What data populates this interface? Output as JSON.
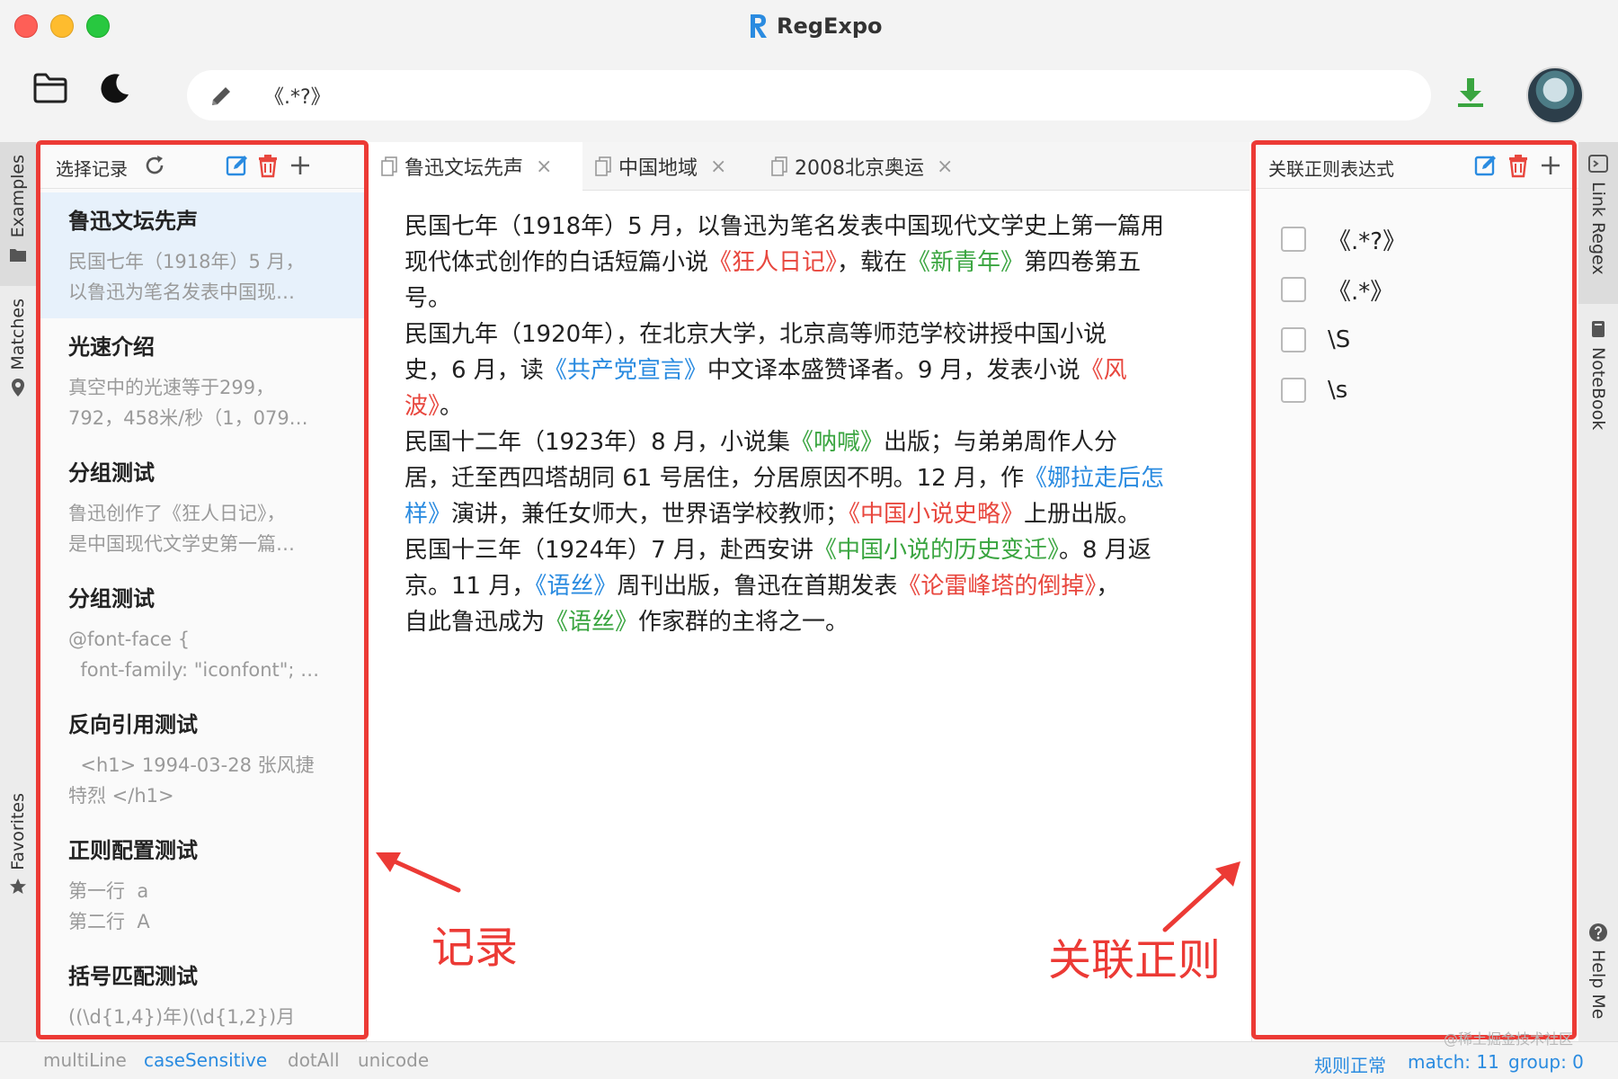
{
  "window": {
    "app_title": "RegExpo"
  },
  "toolbar": {
    "regex_value": "《.*?》"
  },
  "left_tabs": [
    {
      "label": "Examples"
    },
    {
      "label": "Matches"
    },
    {
      "label": "Favorites"
    }
  ],
  "right_tabs": [
    {
      "label": "Link Regex"
    },
    {
      "label": "NoteBook"
    },
    {
      "label": "Help Me"
    }
  ],
  "records_panel": {
    "title": "选择记录",
    "items": [
      {
        "title": "鲁迅文坛先声",
        "preview": "民国七年（1918年）5 月，\n以鲁迅为笔名发表中国现…"
      },
      {
        "title": "光速介绍",
        "preview": "真空中的光速等于299，\n792，458米/秒（1，079…"
      },
      {
        "title": "分组测试",
        "preview": "鲁迅创作了《狂人日记》，\n是中国现代文学史第一篇…"
      },
      {
        "title": "分组测试",
        "preview": "@font-face {\n  font-family: \"iconfont\"; …"
      },
      {
        "title": "反向引用测试",
        "preview": "  <h1> 1994-03-28 张风捷\n特烈 </h1>"
      },
      {
        "title": "正则配置测试",
        "preview": "第一行  a\n第二行  A"
      },
      {
        "title": "括号匹配测试",
        "preview": "((\\d{1,4})年)(\\d{1,2})月"
      }
    ]
  },
  "tabs": [
    {
      "label": "鲁迅文坛先声",
      "close": "×"
    },
    {
      "label": "中国地域",
      "close": "×"
    },
    {
      "label": "2008北京奥运",
      "close": "×"
    }
  ],
  "editor": {
    "paragraphs": [
      {
        "line": "民国七年（1918年）5 月，以鲁迅为笔名发表中国现代文学史上第一篇用"
      },
      {
        "line": "现代体式创作的白话短篇小说《狂人日记》，载在《新青年》第四卷第五"
      },
      {
        "line": "号。"
      },
      {
        "line": "民国九年（1920年），在北京大学，北京高等师范学校讲授中国小说"
      },
      {
        "line": "史，6 月，读《共产党宣言》中文译本盛赞译者。9 月，发表小说《风"
      },
      {
        "line": "波》。"
      },
      {
        "line": "民国十二年（1923年）8 月，小说集《呐喊》出版；与弟弟周作人分"
      },
      {
        "line": "居，迁至西四塔胡同 61 号居住，分居原因不明。12 月，作《娜拉走后怎"
      },
      {
        "line": "样》演讲，兼任女师大，世界语学校教师；《中国小说史略》上册出版。"
      },
      {
        "line": "民国十三年（1924年）7 月，赴西安讲《中国小说的历史变迁》。8 月返"
      },
      {
        "line": "京。11 月，《语丝》周刊出版，鲁迅在首期发表《论雷峰塔的倒掉》，"
      },
      {
        "line": "自此鲁迅成为《语丝》作家群的主将之一。"
      }
    ]
  },
  "linked_panel": {
    "title": "关联正则表达式",
    "items": [
      {
        "expr": "《.*?》"
      },
      {
        "expr": "《.*》"
      },
      {
        "expr": "\\S"
      },
      {
        "expr": "\\s"
      }
    ]
  },
  "annotations": {
    "records_label": "记录",
    "linked_label": "关联正则"
  },
  "status": {
    "flags": [
      {
        "label": "multiLine",
        "enabled": false
      },
      {
        "label": "caseSensitive",
        "enabled": true
      },
      {
        "label": "dotAll",
        "enabled": false
      },
      {
        "label": "unicode",
        "enabled": false
      }
    ],
    "rule_state": "规则正常",
    "match": "match: 11",
    "group": "group: 0",
    "watermark": "@稀土掘金技术社区"
  },
  "colors": {
    "accent": "#2a8be0",
    "annotation": "#ec3a35",
    "highlight_red": "#e8473e",
    "highlight_blue": "#2a8be0",
    "highlight_green": "#3aa540",
    "selected_row": "#e7f1fb"
  },
  "icons": {
    "toolbar": [
      "folder-icon",
      "moon-icon",
      "pencil-icon",
      "download-icon"
    ],
    "panel_actions": [
      "edit-icon",
      "trash-icon",
      "plus-icon"
    ]
  }
}
